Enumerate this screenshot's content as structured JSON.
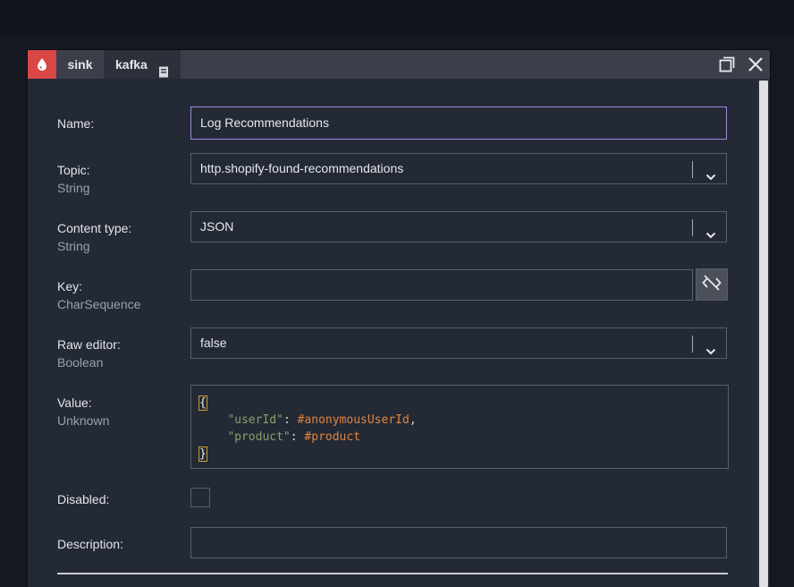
{
  "window": {
    "tabs": [
      {
        "label": "sink"
      },
      {
        "label": "kafka"
      }
    ],
    "icons": {
      "node": "drop-icon",
      "doc": "document-icon",
      "maximize": "maximize-icon",
      "close": "close-icon"
    }
  },
  "form": {
    "name": {
      "label": "Name:",
      "value": "Log Recommendations"
    },
    "topic": {
      "label": "Topic:",
      "type": "String",
      "value": "http.shopify-found-recommendations"
    },
    "content_type": {
      "label": "Content type:",
      "type": "String",
      "value": "JSON"
    },
    "key": {
      "label": "Key:",
      "type": "CharSequence",
      "value": ""
    },
    "raw_editor": {
      "label": "Raw editor:",
      "type": "Boolean",
      "value": "false"
    },
    "value": {
      "label": "Value:",
      "type": "Unknown",
      "code": {
        "open": "{",
        "line1_key": "\"userId\"",
        "line1_sep": ": ",
        "line1_val": "#anonymousUserId",
        "line1_end": ",",
        "line2_key": "\"product\"",
        "line2_sep": ": ",
        "line2_val": "#product",
        "close": "}"
      }
    },
    "disabled": {
      "label": "Disabled:",
      "checked": false
    },
    "description": {
      "label": "Description:",
      "value": ""
    }
  },
  "colors": {
    "accent": "#d94646",
    "focus_border": "#9f8ce0",
    "code_string": "#8aa06a",
    "code_variable": "#e0843f"
  }
}
